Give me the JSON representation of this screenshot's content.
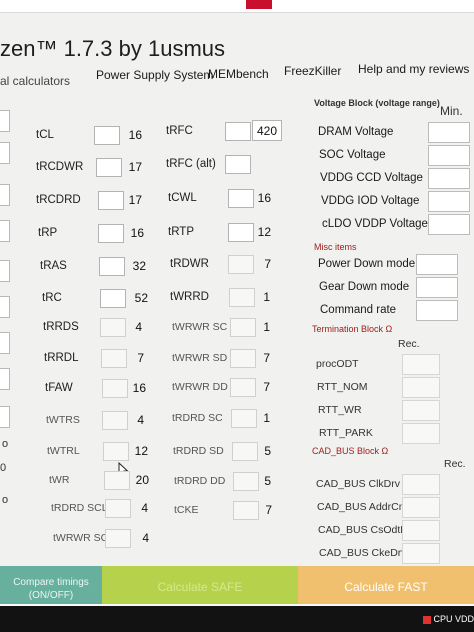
{
  "window": {
    "title": "zen™ 1.7.3 by 1usmus"
  },
  "menu": {
    "current_tab": "al calculators",
    "items": [
      "Power Supply System",
      "MEMbench",
      "FreezKiller",
      "Help and my reviews"
    ]
  },
  "timings_left": [
    {
      "label": "tCL",
      "value": "16"
    },
    {
      "label": "tRCDWR",
      "value": "17"
    },
    {
      "label": "tRCDRD",
      "value": "17"
    },
    {
      "label": "tRP",
      "value": "16"
    },
    {
      "label": "tRAS",
      "value": "32"
    },
    {
      "label": "tRC",
      "value": "52"
    },
    {
      "label": "tRRDS",
      "value": "4"
    },
    {
      "label": "tRRDL",
      "value": "7"
    },
    {
      "label": "tFAW",
      "value": "16"
    },
    {
      "label": "tWTRS",
      "value": "4"
    },
    {
      "label": "tWTRL",
      "value": "12"
    },
    {
      "label": "tWR",
      "value": "20"
    },
    {
      "label": "tRDRD SCL",
      "value": "4"
    },
    {
      "label": "tWRWR SCL",
      "value": "4"
    }
  ],
  "timings_right": [
    {
      "label": "tRFC",
      "value": "420"
    },
    {
      "label": "tRFC (alt)",
      "value": ""
    },
    {
      "label": "tCWL",
      "value": "16"
    },
    {
      "label": "tRTP",
      "value": "12"
    },
    {
      "label": "tRDWR",
      "value": "7"
    },
    {
      "label": "tWRRD",
      "value": "1"
    },
    {
      "label": "tWRWR SC",
      "value": "1"
    },
    {
      "label": "tWRWR SD",
      "value": "7"
    },
    {
      "label": "tWRWR DD",
      "value": "7"
    },
    {
      "label": "tRDRD SC",
      "value": "1"
    },
    {
      "label": "tRDRD SD",
      "value": "5"
    },
    {
      "label": "tRDRD DD",
      "value": "5"
    },
    {
      "label": "tCKE",
      "value": "7"
    }
  ],
  "voltage_block": {
    "title": "Voltage Block (voltage range)",
    "column": "Min.",
    "items": [
      "DRAM Voltage",
      "SOC Voltage",
      "VDDG  CCD Voltage",
      "VDDG  IOD Voltage",
      "cLDO VDDP Voltage"
    ]
  },
  "misc": {
    "title": "Misc items",
    "items": [
      "Power Down mode",
      "Gear Down mode",
      "Command rate"
    ]
  },
  "termination": {
    "title": "Termination Block Ω",
    "column": "Rec.",
    "items": [
      "procODT",
      "RTT_NOM",
      "RTT_WR",
      "RTT_PARK"
    ]
  },
  "cad_bus": {
    "title": "CAD_BUS Block Ω",
    "column": "Rec.",
    "items": [
      "CAD_BUS ClkDrv",
      "CAD_BUS AddrCmdDrv",
      "CAD_BUS CsOdtDrv",
      "CAD_BUS CkeDrv"
    ]
  },
  "footer": {
    "compare_line1": "Compare timings",
    "compare_line2": "(ON/OFF)",
    "safe": "Calculate SAFE",
    "fast": "Calculate FAST"
  },
  "left_edge": {
    "o": "o",
    "zero": "0"
  },
  "taskbar": {
    "tray": "CPU VDD"
  },
  "colors": {
    "compare": "#67b09e",
    "safe": "#b6d24c",
    "fast": "#f0c06e",
    "section_title": "#a31d1d"
  }
}
